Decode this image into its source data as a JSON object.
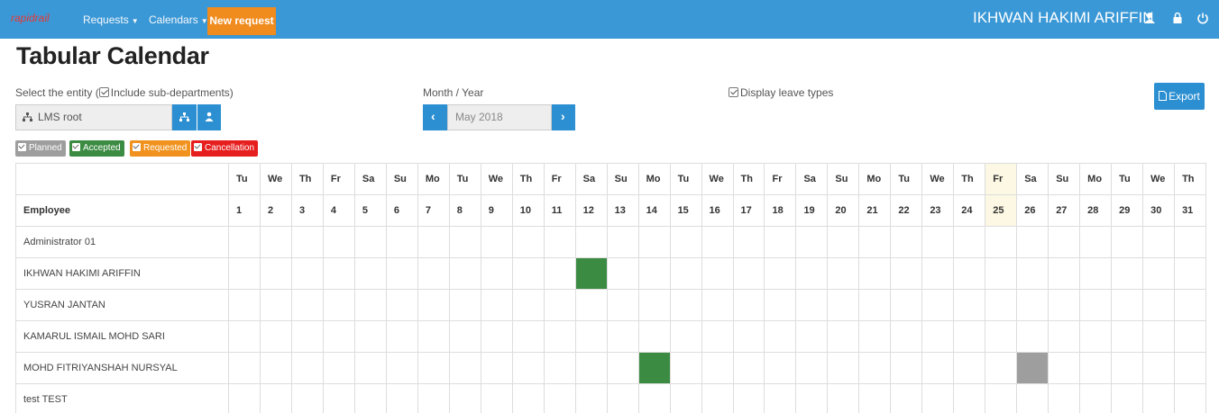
{
  "navbar": {
    "brand": "rapidrail",
    "requests_label": "Requests",
    "calendars_label": "Calendars",
    "new_request_label": "New request",
    "user_name": "IKHWAN HAKIMI ARIFFIN",
    "icons": [
      "user-icon",
      "lock-icon",
      "power-icon"
    ]
  },
  "page": {
    "title": "Tabular Calendar",
    "entity_label": "Select the entity",
    "include_sub_label": "Include sub-departments)",
    "entity_value": "LMS root",
    "month_year_label": "Month / Year",
    "month_value": "May 2018",
    "display_leave_types_label": "Display leave types",
    "export_label": "Export"
  },
  "legend": [
    {
      "label": "Planned",
      "color": "#9e9e9e"
    },
    {
      "label": "Accepted",
      "color": "#3c8b43"
    },
    {
      "label": "Requested",
      "color": "#f0921d"
    },
    {
      "label": "Cancellation",
      "color": "#e61e1e"
    }
  ],
  "calendar": {
    "employee_header": "Employee",
    "day_names": [
      "Tu",
      "We",
      "Th",
      "Fr",
      "Sa",
      "Su",
      "Mo",
      "Tu",
      "We",
      "Th",
      "Fr",
      "Sa",
      "Su",
      "Mo",
      "Tu",
      "We",
      "Th",
      "Fr",
      "Sa",
      "Su",
      "Mo",
      "Tu",
      "We",
      "Th",
      "Fr",
      "Sa",
      "Su",
      "Mo",
      "Tu",
      "We",
      "Th"
    ],
    "day_numbers": [
      "1",
      "2",
      "3",
      "4",
      "5",
      "6",
      "7",
      "8",
      "9",
      "10",
      "11",
      "12",
      "13",
      "14",
      "15",
      "16",
      "17",
      "18",
      "19",
      "20",
      "21",
      "22",
      "23",
      "24",
      "25",
      "26",
      "27",
      "28",
      "29",
      "30",
      "31"
    ],
    "today_day": 25,
    "employees": [
      {
        "name": "Administrator 01",
        "leaves": []
      },
      {
        "name": "IKHWAN HAKIMI ARIFFIN",
        "leaves": [
          {
            "day": 12,
            "status": "accepted"
          }
        ]
      },
      {
        "name": "YUSRAN JANTAN",
        "leaves": []
      },
      {
        "name": "KAMARUL ISMAIL MOHD SARI",
        "leaves": []
      },
      {
        "name": "MOHD FITRIYANSHAH NURSYAL",
        "leaves": [
          {
            "day": 14,
            "status": "accepted"
          },
          {
            "day": 26,
            "status": "planned"
          }
        ]
      },
      {
        "name": "test TEST",
        "leaves": []
      }
    ]
  }
}
